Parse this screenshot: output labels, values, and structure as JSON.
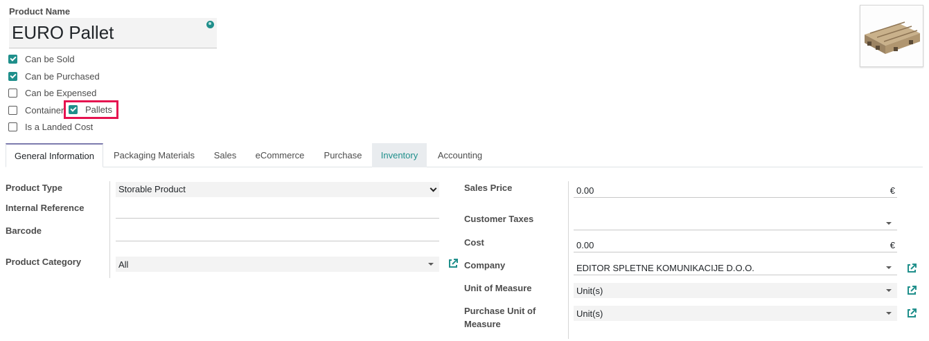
{
  "product": {
    "name_label": "Product Name",
    "name": "EURO Pallet"
  },
  "flags": [
    {
      "label": "Can be Sold",
      "checked": true
    },
    {
      "label": "Can be Purchased",
      "checked": true
    },
    {
      "label": "Can be Expensed",
      "checked": false
    },
    {
      "label": "Container",
      "checked": false
    },
    {
      "label": "Is a Landed Cost",
      "checked": false
    }
  ],
  "pallets": {
    "label": "Pallets",
    "checked": true
  },
  "tabs": [
    "General Information",
    "Packaging Materials",
    "Sales",
    "eCommerce",
    "Purchase",
    "Inventory",
    "Accounting"
  ],
  "left_form": {
    "product_type_label": "Product Type",
    "product_type": "Storable Product",
    "internal_ref_label": "Internal Reference",
    "internal_ref": "",
    "barcode_label": "Barcode",
    "barcode": "",
    "category_label": "Product Category",
    "category": "All"
  },
  "right_form": {
    "sales_price_label": "Sales Price",
    "sales_price": "0.00",
    "currency": "€",
    "customer_taxes_label": "Customer Taxes",
    "customer_taxes": "",
    "cost_label": "Cost",
    "cost": "0.00",
    "company_label": "Company",
    "company": "EDITOR SPLETNE KOMUNIKACIJE D.O.O.",
    "uom_label": "Unit of Measure",
    "uom": "Unit(s)",
    "purchase_uom_label_1": "Purchase Unit of",
    "purchase_uom_label_2": "Measure",
    "purchase_uom": "Unit(s)"
  },
  "colors": {
    "accent": "#1f8f8b",
    "highlight_border": "#e5124f",
    "tab_active_top": "#7c7bad"
  }
}
